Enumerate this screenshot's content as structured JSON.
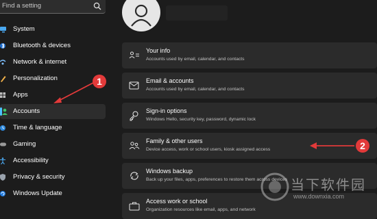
{
  "sidebar": {
    "search": {
      "placeholder": "Find a setting"
    },
    "items": [
      {
        "label": "System",
        "icon": "monitor-icon",
        "active": false
      },
      {
        "label": "Bluetooth & devices",
        "icon": "bluetooth-icon",
        "active": false
      },
      {
        "label": "Network & internet",
        "icon": "network-icon",
        "active": false
      },
      {
        "label": "Personalization",
        "icon": "brush-icon",
        "active": false
      },
      {
        "label": "Apps",
        "icon": "apps-icon",
        "active": false
      },
      {
        "label": "Accounts",
        "icon": "person-icon",
        "active": true
      },
      {
        "label": "Time & language",
        "icon": "globe-clock-icon",
        "active": false
      },
      {
        "label": "Gaming",
        "icon": "gamepad-icon",
        "active": false
      },
      {
        "label": "Accessibility",
        "icon": "accessibility-icon",
        "active": false
      },
      {
        "label": "Privacy & security",
        "icon": "shield-icon",
        "active": false
      },
      {
        "label": "Windows Update",
        "icon": "update-icon",
        "active": false
      }
    ]
  },
  "main": {
    "cards": [
      {
        "title": "Your info",
        "subtitle": "Accounts used by email, calendar, and contacts",
        "icon": "id-card-icon"
      },
      {
        "title": "Email & accounts",
        "subtitle": "Accounts used by email, calendar, and contacts",
        "icon": "mail-icon"
      },
      {
        "title": "Sign-in options",
        "subtitle": "Windows Hello, security key, password, dynamic lock",
        "icon": "key-icon"
      },
      {
        "title": "Family & other users",
        "subtitle": "Device access, work or school users, kiosk assigned access",
        "icon": "people-icon"
      },
      {
        "title": "Windows backup",
        "subtitle": "Back up your files, apps, preferences to restore them across devices",
        "icon": "backup-icon"
      },
      {
        "title": "Access work or school",
        "subtitle": "Organization resources like email, apps, and network",
        "icon": "briefcase-icon"
      }
    ]
  },
  "annotations": {
    "badge_1": "1",
    "badge_2": "2",
    "arrow_color": "#e23a3a"
  },
  "watermark": {
    "title": "当下软件园",
    "url": "www.downxia.com"
  },
  "colors": {
    "background": "#1c1c1c",
    "card": "#2b2b2b",
    "accent": "#4cc2ff"
  }
}
